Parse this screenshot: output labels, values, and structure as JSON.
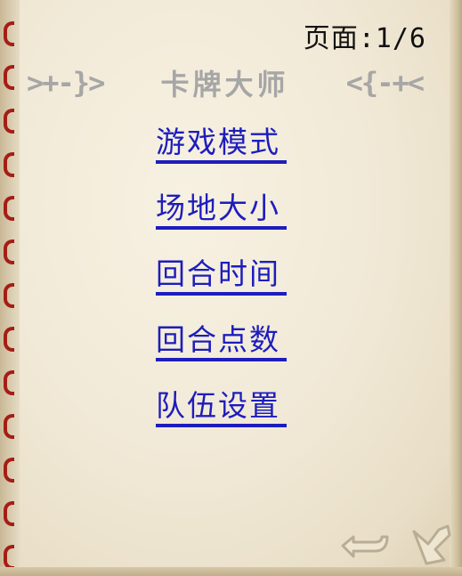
{
  "page_indicator": "页面:1/6",
  "title": {
    "left_deco": ">+-}>",
    "text": "卡牌大师",
    "right_deco": "<{-+<"
  },
  "menu": [
    {
      "label": "游戏模式"
    },
    {
      "label": "场地大小"
    },
    {
      "label": "回合时间"
    },
    {
      "label": "回合点数"
    },
    {
      "label": "队伍设置"
    }
  ],
  "colors": {
    "link": "#1d1dbd",
    "title": "#a6a6a6",
    "ring": "#a51d16",
    "paper": "#f2ead8"
  },
  "icons": {
    "back": "return-arrow-icon",
    "next": "next-page-arrow-icon"
  }
}
